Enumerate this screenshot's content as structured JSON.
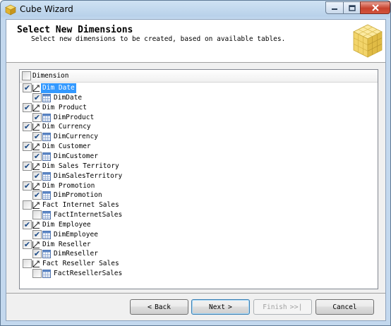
{
  "window": {
    "title": "Cube Wizard"
  },
  "header": {
    "title": "Select New Dimensions",
    "subtitle": "Select new dimensions to be created, based on available tables."
  },
  "list": {
    "column_header": "Dimension",
    "groups": [
      {
        "dimension": "Dim Date",
        "dimension_checked": true,
        "selected": true,
        "table": "DimDate",
        "table_checked": true
      },
      {
        "dimension": "Dim Product",
        "dimension_checked": true,
        "selected": false,
        "table": "DimProduct",
        "table_checked": true
      },
      {
        "dimension": "Dim Currency",
        "dimension_checked": true,
        "selected": false,
        "table": "DimCurrency",
        "table_checked": true
      },
      {
        "dimension": "Dim Customer",
        "dimension_checked": true,
        "selected": false,
        "table": "DimCustomer",
        "table_checked": true
      },
      {
        "dimension": "Dim Sales Territory",
        "dimension_checked": true,
        "selected": false,
        "table": "DimSalesTerritory",
        "table_checked": true
      },
      {
        "dimension": "Dim Promotion",
        "dimension_checked": true,
        "selected": false,
        "table": "DimPromotion",
        "table_checked": true
      },
      {
        "dimension": "Fact Internet Sales",
        "dimension_checked": false,
        "selected": false,
        "table": "FactInternetSales",
        "table_checked": false
      },
      {
        "dimension": "Dim Employee",
        "dimension_checked": true,
        "selected": false,
        "table": "DimEmployee",
        "table_checked": true
      },
      {
        "dimension": "Dim Reseller",
        "dimension_checked": true,
        "selected": false,
        "table": "DimReseller",
        "table_checked": true
      },
      {
        "dimension": "Fact Reseller Sales",
        "dimension_checked": false,
        "selected": false,
        "table": "FactResellerSales",
        "table_checked": false
      }
    ]
  },
  "buttons": {
    "back": {
      "prefix": "<",
      "label": "Back"
    },
    "next": {
      "label": "Next",
      "suffix": ">"
    },
    "finish": {
      "label": "Finish",
      "suffix": ">>|"
    },
    "cancel": {
      "label": "Cancel"
    }
  },
  "colors": {
    "selection": "#3399ff",
    "check": "#1c4a86"
  }
}
